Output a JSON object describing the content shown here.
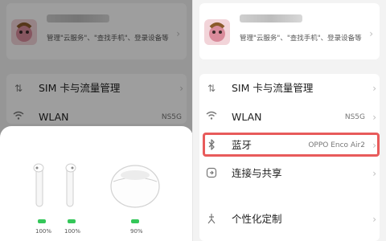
{
  "left": {
    "account": {
      "desc": "管理\"云服务\"、\"查找手机\"、登录设备等"
    },
    "rows": [
      {
        "label": "SIM 卡与流量管理",
        "value": ""
      },
      {
        "label": "WLAN",
        "value": "NS5G"
      }
    ],
    "sheet": {
      "battery_left": "100%",
      "battery_right": "100%",
      "battery_case": "90%"
    }
  },
  "right": {
    "account": {
      "desc": "管理\"云服务\"、\"查找手机\"、登录设备等"
    },
    "rows": [
      {
        "label": "SIM 卡与流量管理",
        "value": ""
      },
      {
        "label": "WLAN",
        "value": "NS5G"
      },
      {
        "label": "蓝牙",
        "value": "OPPO Enco Air2"
      },
      {
        "label": "连接与共享",
        "value": ""
      },
      {
        "label": "个性化定制",
        "value": ""
      }
    ]
  },
  "colors": {
    "highlight": "#e85b5b",
    "battery": "#34c759"
  },
  "icons": {
    "sim": "sim-icon",
    "wlan": "wifi-icon",
    "bluetooth": "bluetooth-icon",
    "connect": "connect-share-icon",
    "personalize": "personalize-icon"
  }
}
